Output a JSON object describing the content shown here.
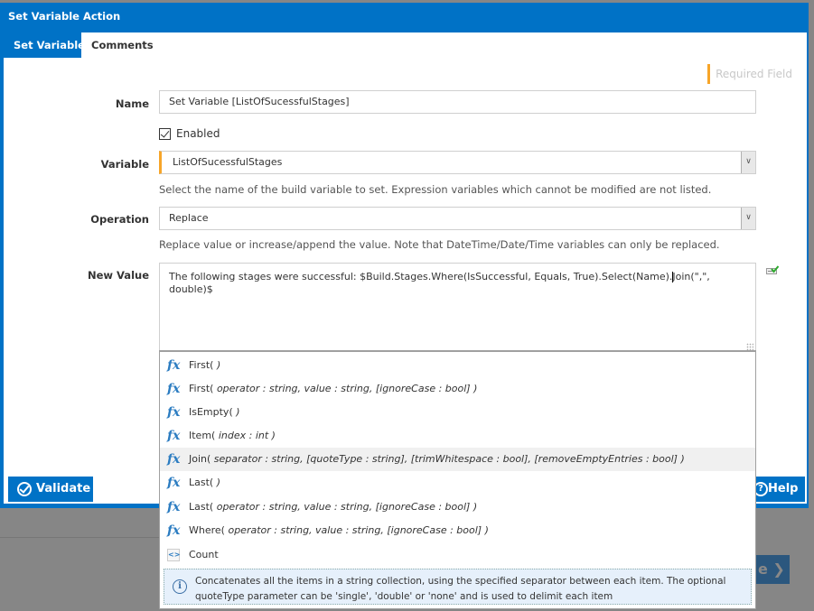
{
  "dialog": {
    "title": "Set Variable Action",
    "tabs": [
      {
        "label": "Set Variable",
        "active": true
      },
      {
        "label": "Comments",
        "active": false
      }
    ],
    "required_legend": "Required Field",
    "accent_color": "#0072c6",
    "required_color": "#f7a529"
  },
  "form": {
    "name": {
      "label": "Name",
      "value": "Set Variable [ListOfSucessfulStages]"
    },
    "enabled": {
      "label": "Enabled",
      "checked": true
    },
    "variable": {
      "label": "Variable",
      "value": "ListOfSucessfulStages",
      "help": "Select the name of the build variable to set. Expression variables which cannot be modified are not listed."
    },
    "operation": {
      "label": "Operation",
      "value": "Replace",
      "help": "Replace value or increase/append the value. Note that DateTime/Date/Time variables can only be replaced."
    },
    "new_value": {
      "label": "New Value",
      "value_before_caret": "The following stages were successful: $Build.Stages.Where(IsSuccessful, Equals, True).Select(Name).",
      "value_after_caret": "Join(\",\", double)$"
    }
  },
  "buttons": {
    "validate": "Validate",
    "help": "Help",
    "background_next": "e ❯"
  },
  "autocomplete": {
    "items": [
      {
        "icon": "function-icon",
        "name": "First(",
        "params": " )"
      },
      {
        "icon": "function-icon",
        "name": "First(",
        "params": " operator : string, value : string, [ignoreCase : bool] )"
      },
      {
        "icon": "function-icon",
        "name": "IsEmpty(",
        "params": " )"
      },
      {
        "icon": "function-icon",
        "name": "Item(",
        "params": " index : int )"
      },
      {
        "icon": "function-icon",
        "name": "Join(",
        "params": " separator : string, [quoteType : string], [trimWhitespace : bool], [removeEmptyEntries : bool] )",
        "highlighted": true
      },
      {
        "icon": "function-icon",
        "name": "Last(",
        "params": " )"
      },
      {
        "icon": "function-icon",
        "name": "Last(",
        "params": " operator : string, value : string, [ignoreCase : bool] )"
      },
      {
        "icon": "function-icon",
        "name": "Where(",
        "params": " operator : string, value : string, [ignoreCase : bool] )"
      },
      {
        "icon": "property-icon",
        "name": "Count",
        "params": ""
      }
    ],
    "info_line1": "Concatenates all the items in a string collection, using the specified separator between each item. The optional",
    "info_line2": "quoteType parameter can be 'single', 'double' or 'none' and is used to delimit each item"
  }
}
